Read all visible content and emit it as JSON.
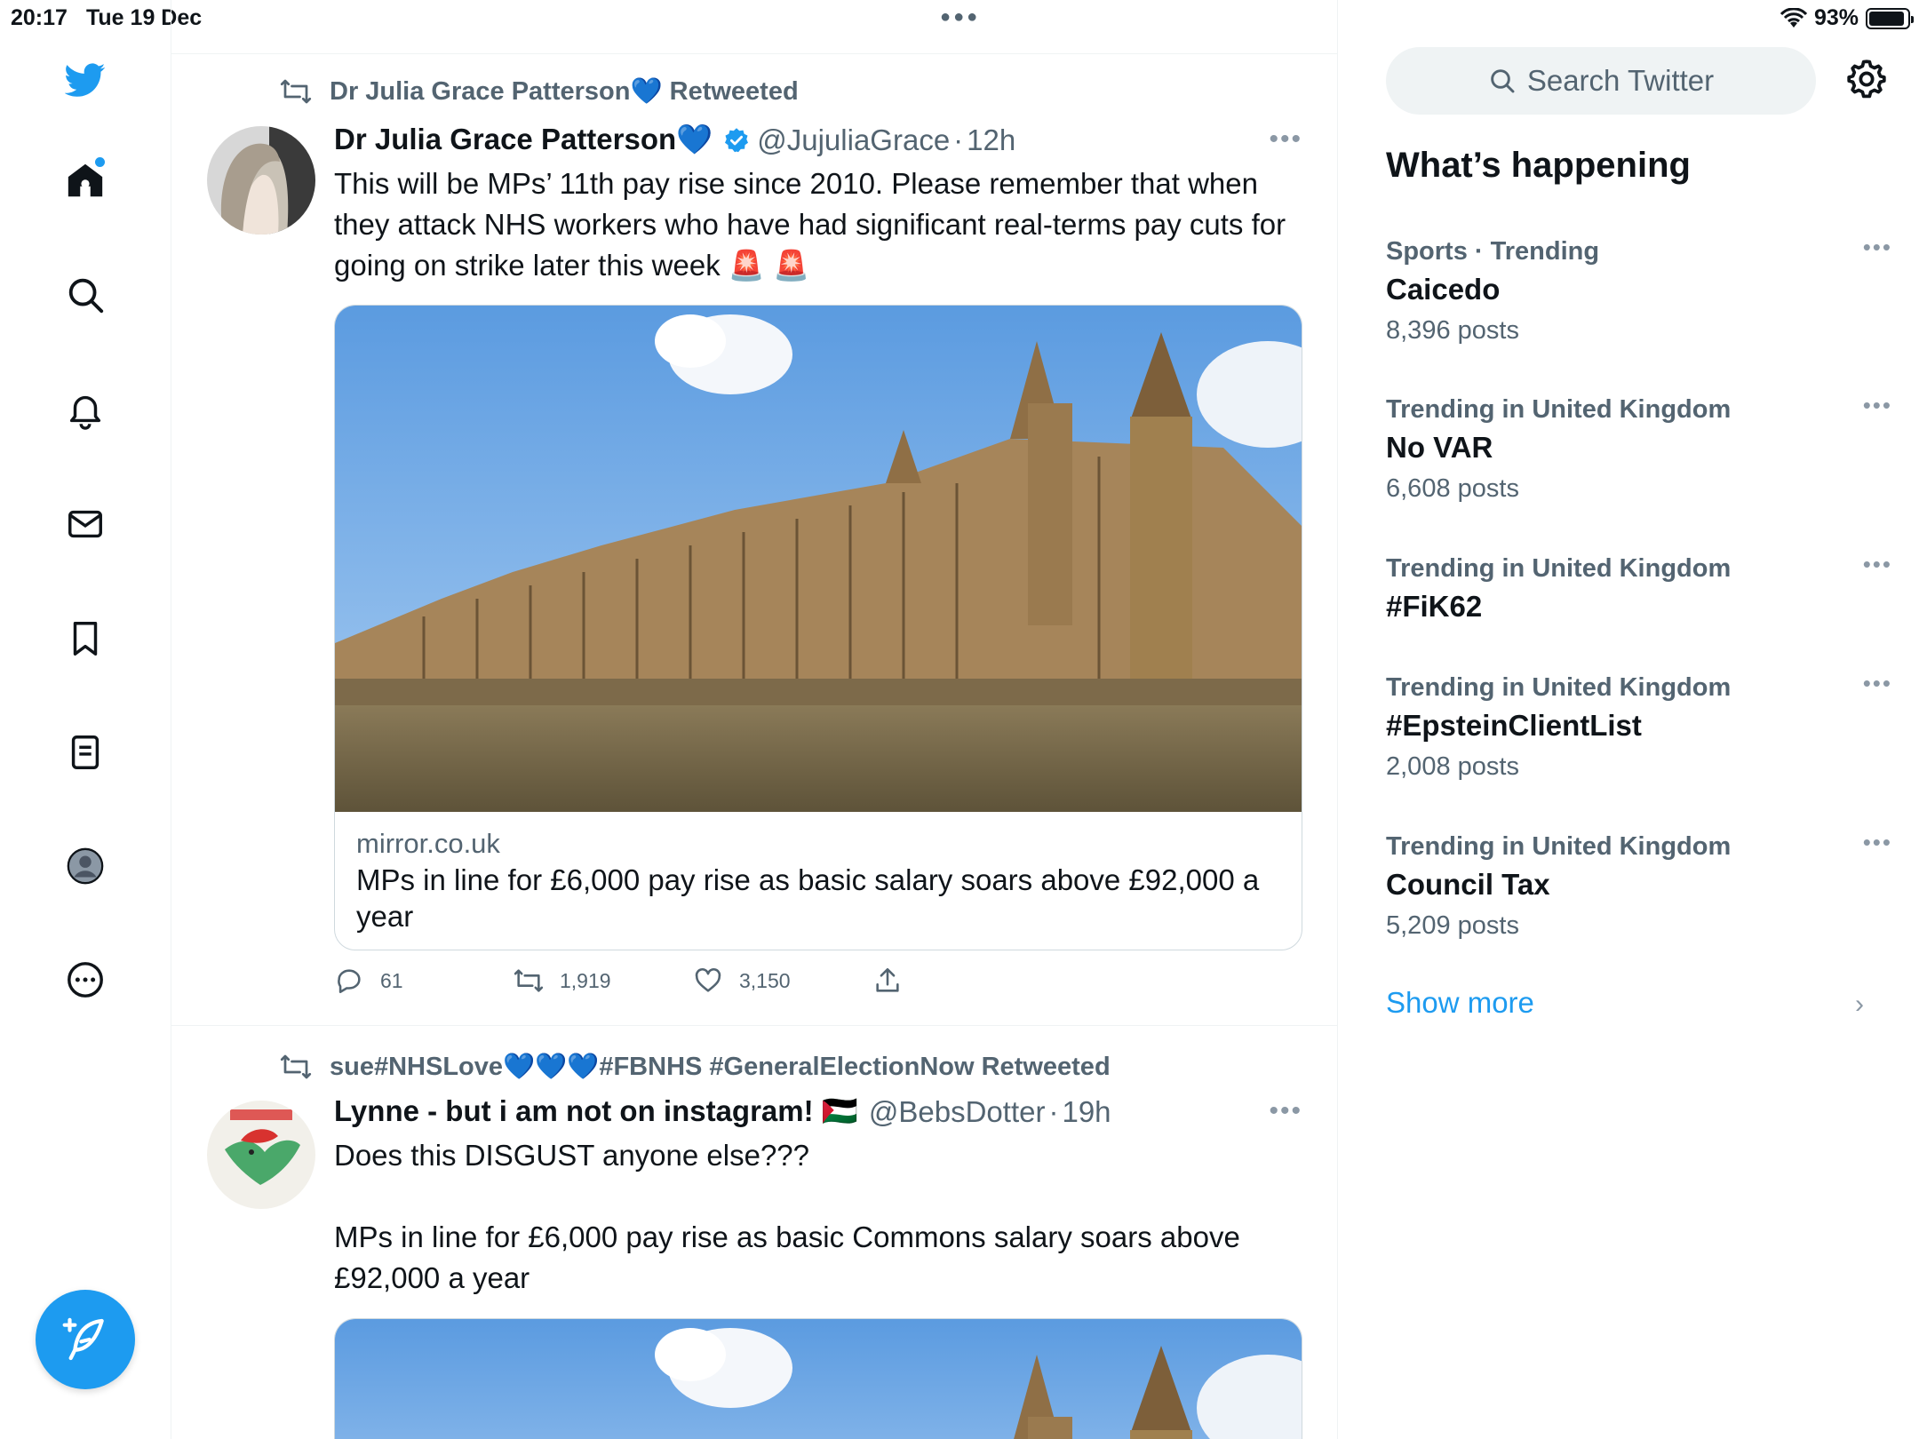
{
  "status_bar": {
    "time": "20:17",
    "date": "Tue 19 Dec",
    "battery": "93%",
    "battery_level": 0.93
  },
  "nav": {
    "items": [
      "twitter-logo",
      "home",
      "explore",
      "notifications",
      "messages",
      "bookmarks",
      "lists",
      "profile",
      "more"
    ],
    "compose_icon": "compose-plus-feather-icon",
    "accent": "#1d9bf0"
  },
  "tweets": [
    {
      "retweeted_by": "Dr Julia Grace Patterson💙 Retweeted",
      "name": "Dr Julia Grace Patterson💙",
      "handle": "@JujuliaGrace",
      "separator": "·",
      "time": "12h",
      "verified": true,
      "text": "This will be MPs’ 11th pay rise since 2010. Please remember that when they attack NHS workers who have had significant real-terms pay cuts for going on strike later this week 🚨 🚨",
      "card": {
        "domain": "mirror.co.uk",
        "title": "MPs in line for £6,000 pay rise as basic salary soars above £92,000 a year"
      },
      "replies": "61",
      "retweets": "1,919",
      "likes": "3,150"
    },
    {
      "retweeted_by": "sue#NHSLove💙💙💙#FBNHS #GeneralElectionNow Retweeted",
      "name": "Lynne - but i am not on instagram! 🇵🇸",
      "handle": "@BebsDotter",
      "separator": "·",
      "time": "19h",
      "verified": false,
      "text_line1": "Does this DISGUST anyone else???",
      "text_line2": "MPs in line for £6,000 pay rise as basic Commons salary soars above £92,000 a year"
    }
  ],
  "right": {
    "search_placeholder": "Search Twitter",
    "heading": "What’s happening",
    "trends": [
      {
        "category": "Sports · Trending",
        "name": "Caicedo",
        "posts": "8,396 posts"
      },
      {
        "category": "Trending in United Kingdom",
        "name": "No VAR",
        "posts": "6,608 posts"
      },
      {
        "category": "Trending in United Kingdom",
        "name": "#FiK62",
        "posts": ""
      },
      {
        "category": "Trending in United Kingdom",
        "name": "#EpsteinClientList",
        "posts": "2,008 posts"
      },
      {
        "category": "Trending in United Kingdom",
        "name": "Council Tax",
        "posts": "5,209 posts"
      }
    ],
    "show_more": "Show more"
  }
}
